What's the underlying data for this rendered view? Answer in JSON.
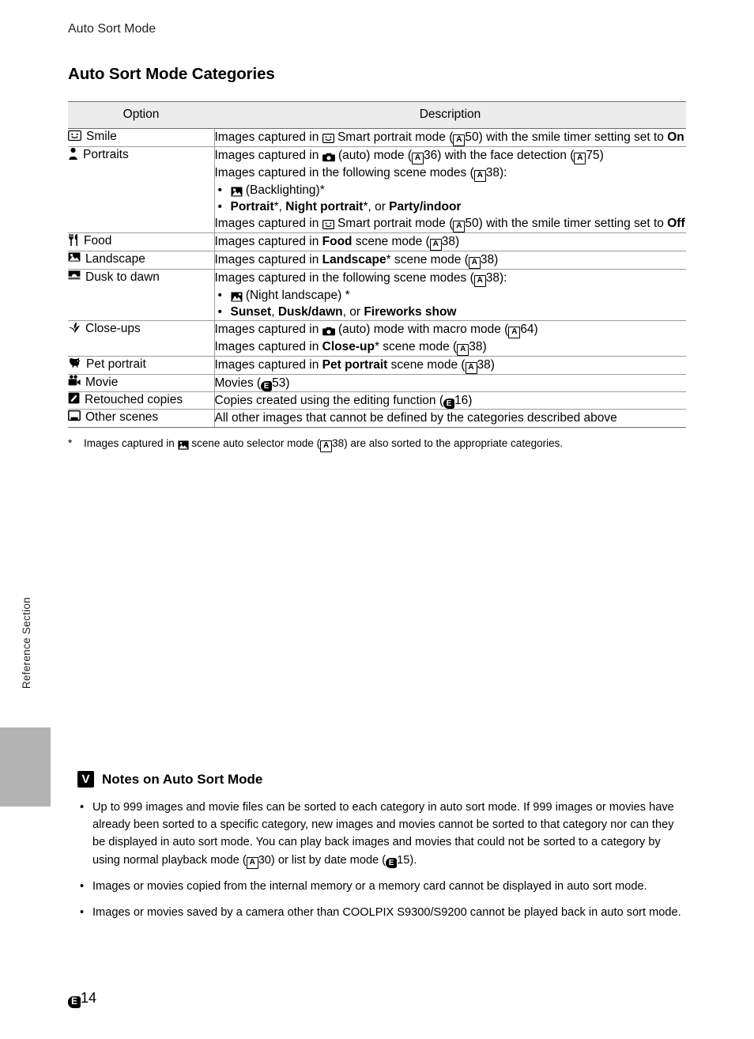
{
  "page": {
    "running_head": "Auto Sort Mode",
    "side_tab_label": "Reference Section",
    "folio_number": "14",
    "section_title": "Auto Sort Mode Categories"
  },
  "table": {
    "headers": {
      "option": "Option",
      "description": "Description"
    },
    "rows": [
      {
        "icon": "smile-icon",
        "option": "Smile",
        "lines": [
          "Images captured in ☺ Smart portrait mode (A50) with the smile timer setting set to On"
        ]
      },
      {
        "icon": "portrait-person-icon",
        "option": "Portraits",
        "lines": [
          "Images captured in (auto) mode (A36) with the face detection (A75)",
          "Images captured in the following scene modes (A38):",
          "(Backlighting)*",
          "Portrait*, Night portrait*, or Party/indoor",
          "Images captured in Smart portrait mode (A50) with the smile timer setting set to Off"
        ]
      },
      {
        "icon": "food-icon",
        "option": "Food",
        "lines": [
          "Images captured in Food scene mode (A38)"
        ]
      },
      {
        "icon": "landscape-icon",
        "option": "Landscape",
        "lines": [
          "Images captured in Landscape* scene mode (A38)"
        ]
      },
      {
        "icon": "dusk-dawn-icon",
        "option": "Dusk to dawn",
        "lines": [
          "Images captured in the following scene modes (A38):",
          "(Night landscape) *",
          "Sunset, Dusk/dawn, or Fireworks show"
        ]
      },
      {
        "icon": "close-up-flower-icon",
        "option": "Close-ups",
        "lines": [
          "Images captured in (auto) mode with macro mode (A64)",
          "Images captured in Close-up* scene mode (A38)"
        ]
      },
      {
        "icon": "pet-portrait-icon",
        "option": "Pet portrait",
        "lines": [
          "Images captured in Pet portrait scene mode (A38)"
        ]
      },
      {
        "icon": "movie-camera-icon",
        "option": "Movie",
        "lines": [
          "Movies (E53)"
        ]
      },
      {
        "icon": "retouch-icon",
        "option": "Retouched copies",
        "lines": [
          "Copies created using the editing function (E16)"
        ]
      },
      {
        "icon": "other-scenes-icon",
        "option": "Other scenes",
        "lines": [
          "All other images that cannot be defined by the categories described above"
        ]
      }
    ],
    "footnote": "Images captured in ☒ scene auto selector mode (A38) are also sorted to the appropriate categories."
  },
  "cells": {
    "smile_desc_a": "Images captured in ",
    "smile_desc_b": " Smart portrait mode (",
    "smile_desc_c": "50) with the smile timer setting set to ",
    "smile_desc_on": "On",
    "portraits_l1a": "Images captured in ",
    "portraits_l1b": " (auto) mode (",
    "portraits_l1c": "36) with the face detection (",
    "portraits_l1d": "75)",
    "portraits_l2a": "Images captured in the following scene modes (",
    "portraits_l2b": "38):",
    "portraits_l3": "(Backlighting)*",
    "portraits_l4a": "Portrait",
    "portraits_l4b": "*, ",
    "portraits_l4c": "Night portrait",
    "portraits_l4d": "*, or ",
    "portraits_l4e": "Party/indoor",
    "portraits_l5a": "Images captured in ",
    "portraits_l5b": " Smart portrait mode (",
    "portraits_l5c": "50) with the smile timer setting set to ",
    "portraits_l5_off": "Off",
    "food_a": "Images captured in ",
    "food_b": "Food",
    "food_c": " scene mode (",
    "food_d": "38)",
    "landscape_a": "Images captured in ",
    "landscape_b": "Landscape",
    "landscape_c": "* scene mode (",
    "landscape_d": "38)",
    "dusk_l1a": "Images captured in the following scene modes (",
    "dusk_l1b": "38):",
    "dusk_l2": "(Night landscape) *",
    "dusk_l3a": "Sunset",
    "dusk_l3b": ", ",
    "dusk_l3c": "Dusk/dawn",
    "dusk_l3d": ", or ",
    "dusk_l3e": "Fireworks show",
    "closeup_l1a": "Images captured in ",
    "closeup_l1b": " (auto) mode with macro mode (",
    "closeup_l1c": "64)",
    "closeup_l2a": "Images captured in ",
    "closeup_l2b": "Close-up",
    "closeup_l2c": "* scene mode (",
    "closeup_l2d": "38)",
    "pet_a": "Images captured in ",
    "pet_b": "Pet portrait",
    "pet_c": " scene mode (",
    "pet_d": "38)",
    "movie_a": "Movies (",
    "movie_b": "53)",
    "retouch_a": "Copies created using the editing function (",
    "retouch_b": "16)",
    "other_a": "All other images that cannot be defined by the categories described above",
    "footnote_a": "Images captured in ",
    "footnote_b": " scene auto selector mode (",
    "footnote_c": "38) are also sorted to the appropriate categories.",
    "star": "*"
  },
  "notes": {
    "title": "Notes on Auto Sort Mode",
    "items": [
      {
        "a": "Up to 999 images and movie files can be sorted to each category in auto sort mode. If 999 images or movies have already been sorted to a specific category, new images and movies cannot be sorted to that category nor can they be displayed in auto sort mode. You can play back images and movies that could not be sorted to a category by using normal playback mode (",
        "b": "30) or list by date mode (",
        "c": "15)."
      },
      {
        "a": "Images or movies copied from the internal memory or a memory card cannot be displayed in auto sort mode."
      },
      {
        "a": "Images or movies saved by a camera other than COOLPIX S9300/S9200 cannot be played back in auto sort mode."
      }
    ]
  },
  "glyphs": {
    "A": "A",
    "E": "E",
    "V": "V"
  }
}
